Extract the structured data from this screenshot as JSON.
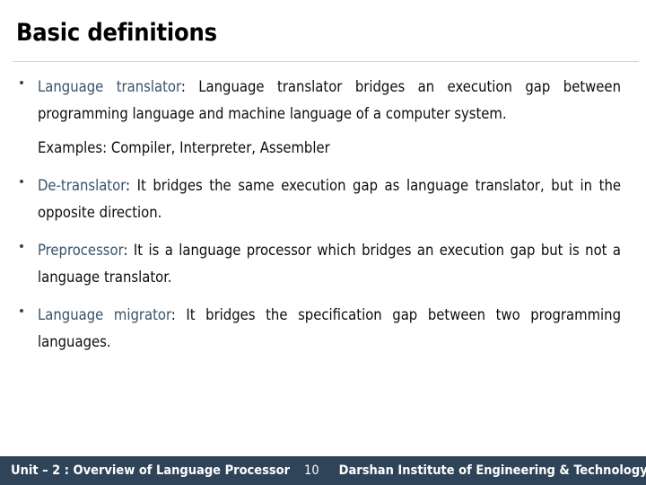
{
  "slide": {
    "title": "Basic definitions",
    "accent_color": "#38536b",
    "footer_bg_color": "#2f4458",
    "body_text_color": "#0d0d0d",
    "rule_color": "#d4d4d4"
  },
  "bullets": [
    {
      "term": "Language translator",
      "separator": ": ",
      "text": "Language translator bridges an execution gap between programming language and machine language of a computer system.",
      "sub_line": "Examples: Compiler, Interpreter, Assembler"
    },
    {
      "term": "De-translator",
      "separator": ": ",
      "text": "It bridges the same execution gap as language translator, but in the opposite direction.",
      "sub_line": ""
    },
    {
      "term": "Preprocessor",
      "separator": ": ",
      "text": "It is a language processor which bridges an execution gap but is not a language translator.",
      "sub_line": ""
    },
    {
      "term": "Language migrator",
      "separator": ": ",
      "text": "It bridges the specification gap between two programming languages.",
      "sub_line": ""
    }
  ],
  "footer": {
    "left": "Unit – 2 : Overview of Language Processor",
    "page_number": "10",
    "right": "Darshan Institute of Engineering & Technology"
  }
}
